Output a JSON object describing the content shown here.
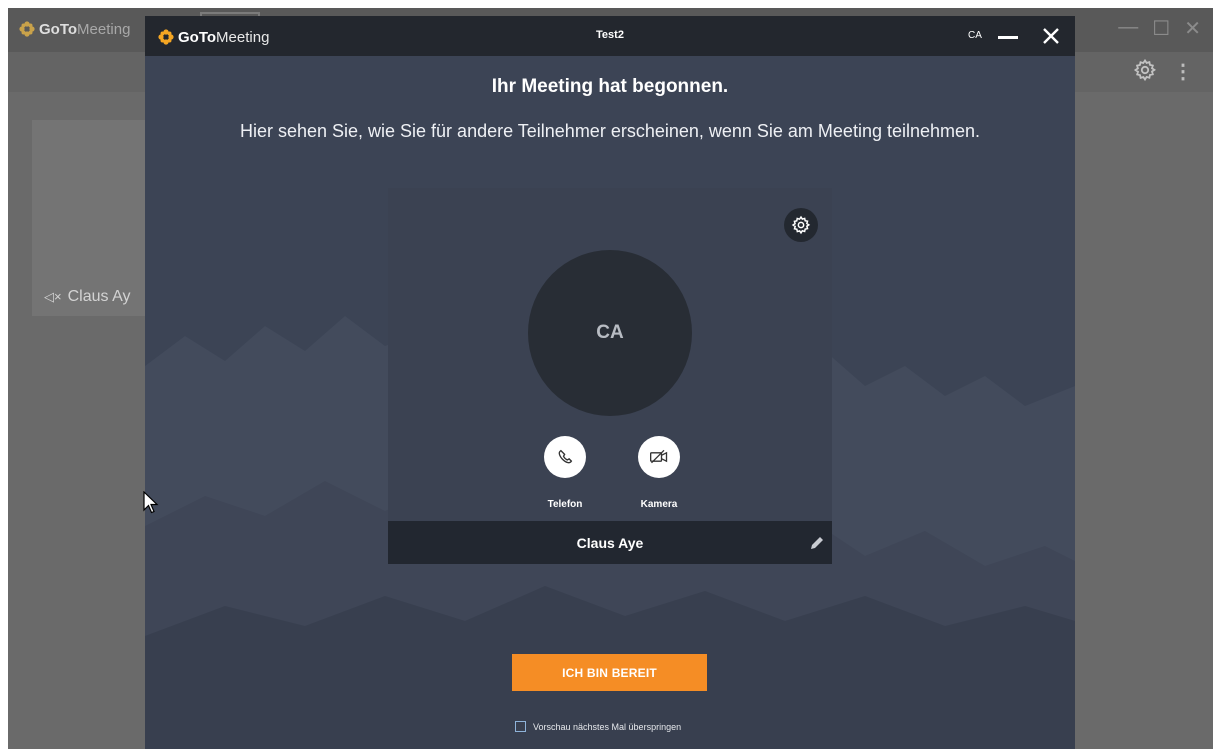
{
  "background_app": {
    "logo_goto": "GoTo",
    "logo_meeting": "Meeting",
    "tile_name": "Claus Ay"
  },
  "dialog": {
    "logo_goto": "GoTo",
    "logo_meeting": "Meeting",
    "window_title": "Test2",
    "user_initials": "CA",
    "heading": "Ihr Meeting hat begonnen.",
    "subheading": "Hier sehen Sie, wie Sie für andere Teilnehmer erscheinen, wenn Sie am Meeting teilnehmen.",
    "preview": {
      "avatar_initials": "CA",
      "phone_label": "Telefon",
      "camera_label": "Kamera",
      "display_name": "Claus Aye"
    },
    "ready_button": "ICH BIN BEREIT",
    "skip_preview_label": "Vorschau nächstes Mal überspringen",
    "skip_preview_checked": false
  },
  "colors": {
    "accent_orange": "#f58d25",
    "dialog_bg": "#3c4455",
    "titlebar_bg": "#23272e"
  }
}
